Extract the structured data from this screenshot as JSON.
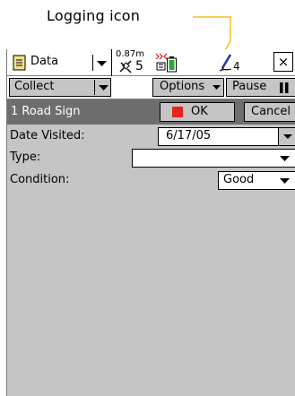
{
  "annotation": {
    "label": "Logging icon"
  },
  "statusbar": {
    "app_label": "Data",
    "app_icon": "document-icon",
    "accuracy": "0.87m",
    "satellites": "5",
    "logging_count": "4",
    "close_label": "×"
  },
  "toolbar": {
    "collect_label": "Collect",
    "options_label": "Options",
    "pause_label": "Pause"
  },
  "feature": {
    "name": "1 Road Sign",
    "ok_label": "OK",
    "cancel_label": "Cancel"
  },
  "form": {
    "fields": [
      {
        "label": "Date Visited:",
        "value": "6/17/05"
      },
      {
        "label": "Type:",
        "value": ""
      },
      {
        "label": "Condition:",
        "value": "Good"
      }
    ]
  },
  "colors": {
    "background": "#c5c5c5",
    "feature_bar": "#6e6e6e",
    "ok_indicator": "#e5241c",
    "annotation_line": "#f0c020"
  }
}
